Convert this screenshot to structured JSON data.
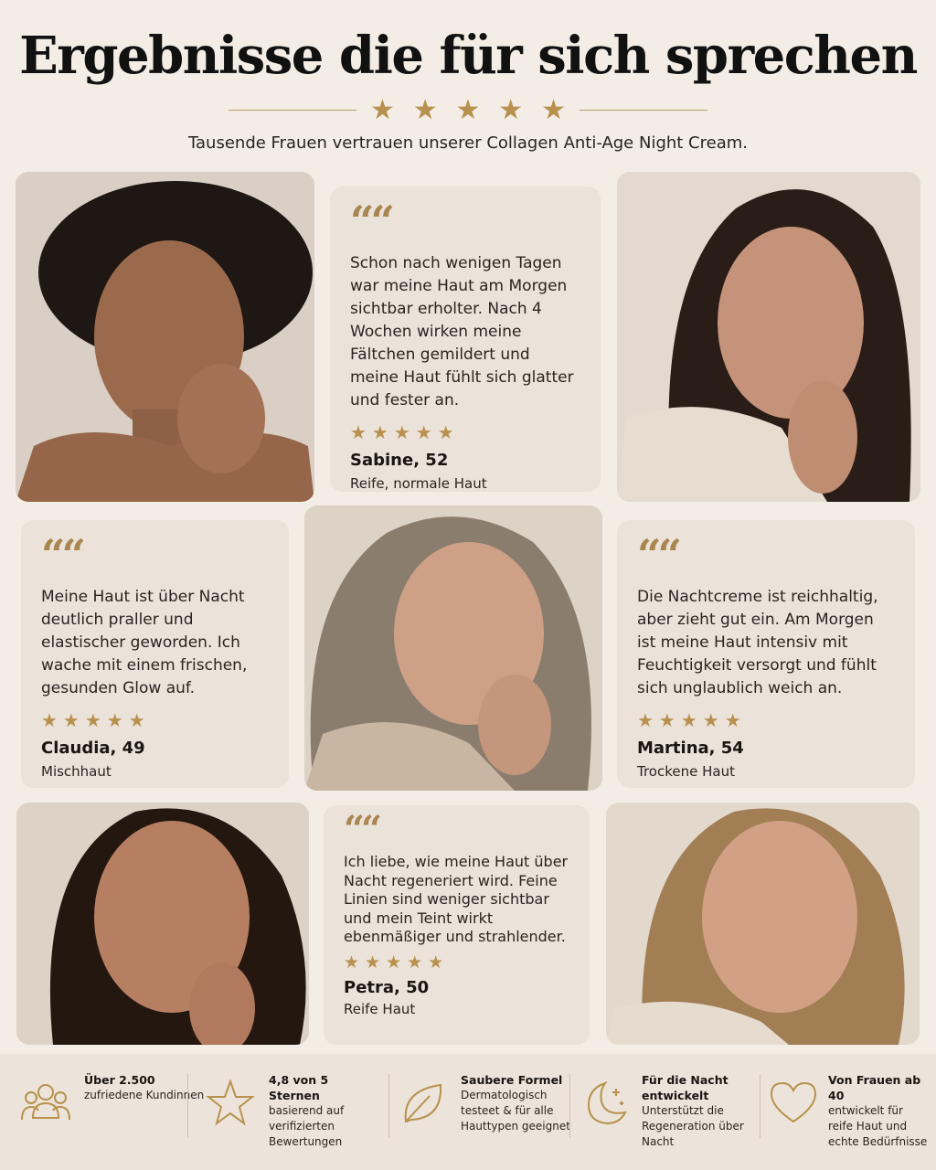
{
  "header": {
    "title": "Ergebnisse die für sich sprechen",
    "stars": "★★★★★",
    "subtitle": "Tausende Frauen vertrauen unserer Collagen Anti-Age Night Cream."
  },
  "testimonials": [
    {
      "quote": "Schon nach wenigen Tagen war meine Haut am Morgen sichtbar erholter. Nach 4 Wochen wirken meine Fältchen gemildert und meine Haut fühlt sich glatter und fester an.",
      "stars": "★★★★★",
      "name": "Sabine, 52",
      "skin": "Reife, normale Haut"
    },
    {
      "quote": "Meine Haut ist über Nacht deutlich praller und elastischer geworden. Ich wache mit einem frischen, gesunden Glow auf.",
      "stars": "★★★★★",
      "name": "Claudia, 49",
      "skin": "Mischhaut"
    },
    {
      "quote": "Die Nachtcreme ist reichhaltig, aber zieht gut ein. Am Morgen ist meine Haut intensiv mit Feuchtigkeit versorgt und fühlt sich unglaublich weich an.",
      "stars": "★★★★★",
      "name": "Martina, 54",
      "skin": "Trockene Haut"
    },
    {
      "quote": "Ich liebe, wie meine Haut über Nacht regeneriert wird. Feine Linien sind weniger sichtbar und mein Teint wirkt ebenmäßiger und strahlender.",
      "stars": "★★★★★",
      "name": "Petra, 50",
      "skin": "Reife Haut"
    }
  ],
  "quote_mark": "“",
  "features": [
    {
      "icon": "users-icon",
      "title": "Über 2.500",
      "text": "zufriedene Kundinnen"
    },
    {
      "icon": "star-icon",
      "title": "4,8 von 5 Sternen",
      "text": "basierend auf verifizierten Bewertungen"
    },
    {
      "icon": "leaf-icon",
      "title": "Saubere Formel",
      "text": "Dermatologisch testeet & für alle Hauttypen geeignet"
    },
    {
      "icon": "moon-icon",
      "title": "Für die Nacht entwickelt",
      "text": "Unterstützt die Regeneration über Nacht"
    },
    {
      "icon": "heart-icon",
      "title": "Von Frauen ab 40",
      "text": "entwickelt für reife Haut und echte Bedürfnisse"
    }
  ],
  "colors": {
    "background": "#f3ede6",
    "card": "#ebe2d9",
    "gold": "#b8914e",
    "text": "#2a2420"
  }
}
